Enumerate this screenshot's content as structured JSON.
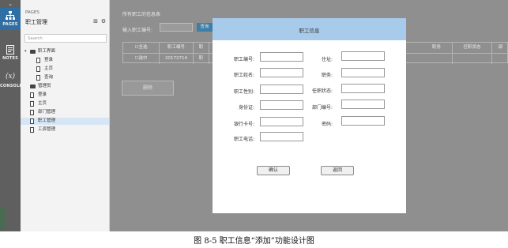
{
  "sidebar": {
    "pages_label": "PAGES",
    "notes_label": "NOTES",
    "console_label": "CONSOLE",
    "console_glyph": "(x)"
  },
  "pages_panel": {
    "caption": "PAGES",
    "project_title": "职工管理",
    "search_placeholder": "Search",
    "tree": [
      {
        "label": "职工界面",
        "type": "folder",
        "expanded": true
      },
      {
        "label": "登录",
        "type": "page"
      },
      {
        "label": "主页",
        "type": "page"
      },
      {
        "label": "查询",
        "type": "page"
      },
      {
        "label": "管理员",
        "type": "folder"
      },
      {
        "label": "登录",
        "type": "page"
      },
      {
        "label": "主页",
        "type": "page"
      },
      {
        "label": "部门管理",
        "type": "page"
      },
      {
        "label": "职工管理",
        "type": "page",
        "selected": true
      },
      {
        "label": "工资管理",
        "type": "page"
      }
    ]
  },
  "canvas": {
    "heading": "所有职工的信息表",
    "search_label": "输入职工编号:",
    "query_button": "查询",
    "table": {
      "header": [
        "☐全选",
        "职工编号",
        "职",
        "职务",
        "任职状态",
        "部"
      ],
      "row": [
        "☐选中",
        "20172714",
        "职"
      ]
    },
    "delete_button": "删除"
  },
  "modal": {
    "title": "职工信息",
    "left_fields": [
      "职工编号:",
      "职工姓名:",
      "职工性别:",
      "身份证:",
      "银行卡号:",
      "职工电话:"
    ],
    "right_fields": [
      "住址:",
      "职务:",
      "任职状态:",
      "部门编号:",
      "密码:"
    ],
    "confirm_button": "确认",
    "back_button": "返回"
  },
  "caption": "图 8-5  职工信息“添加”功能设计图",
  "colors": {
    "modal_header": "#a8cbeb",
    "active_sidebar": "#2f6fa3",
    "overlay": "#8f8f8f"
  }
}
